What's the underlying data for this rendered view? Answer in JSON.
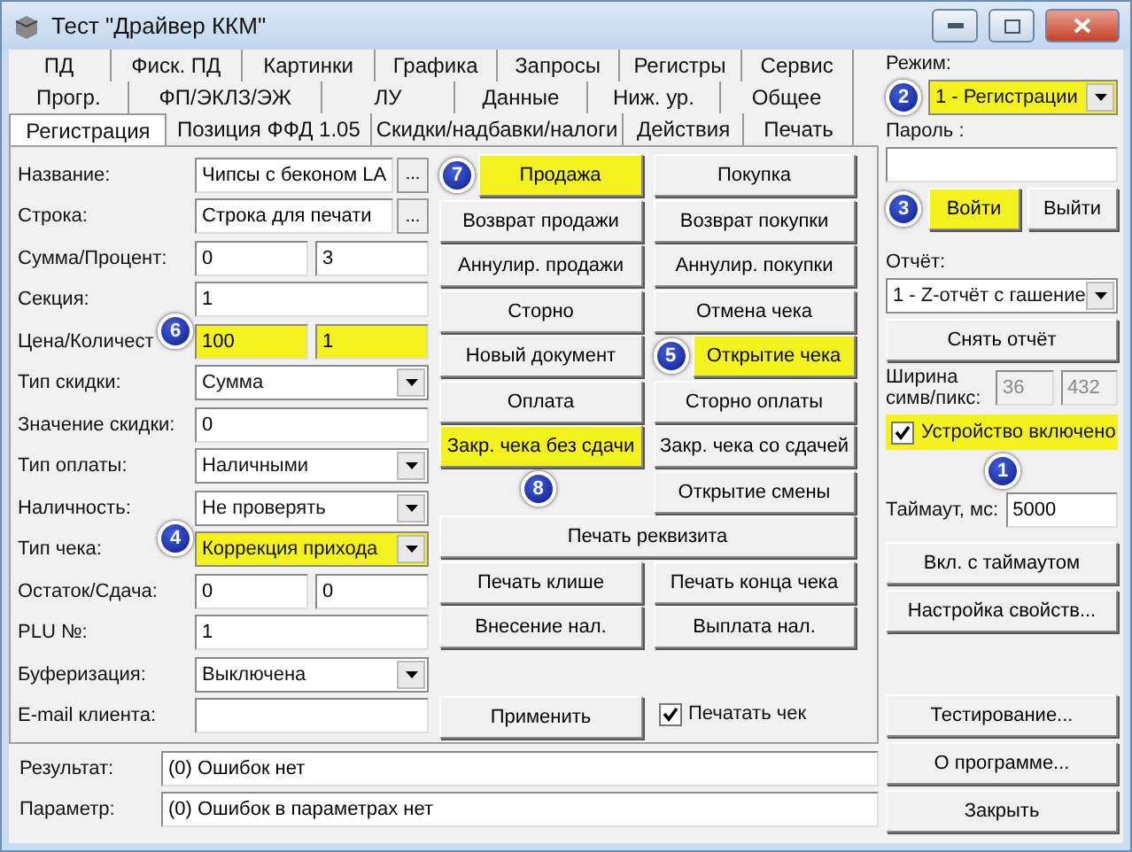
{
  "window": {
    "title": "Тест \"Драйвер ККМ\""
  },
  "tab_rows": [
    [
      {
        "label": "ПД",
        "selected": false
      },
      {
        "label": "Фиск. ПД",
        "selected": false
      },
      {
        "label": "Картинки",
        "selected": false
      },
      {
        "label": "Графика",
        "selected": false
      },
      {
        "label": "Запросы",
        "selected": false
      },
      {
        "label": "Регистры",
        "selected": false
      },
      {
        "label": "Сервис",
        "selected": false
      }
    ],
    [
      {
        "label": "Прогр.",
        "selected": false
      },
      {
        "label": "ФП/ЭКЛЗ/ЭЖ",
        "selected": false
      },
      {
        "label": "ЛУ",
        "selected": false
      },
      {
        "label": "Данные",
        "selected": false
      },
      {
        "label": "Ниж. ур.",
        "selected": false
      },
      {
        "label": "Общее",
        "selected": false
      }
    ],
    [
      {
        "label": "Регистрация",
        "selected": true
      },
      {
        "label": "Позиция ФФД 1.05",
        "selected": false
      },
      {
        "label": "Скидки/надбавки/налоги",
        "selected": false
      },
      {
        "label": "Действия",
        "selected": false
      },
      {
        "label": "Печать",
        "selected": false
      }
    ]
  ],
  "form": [
    {
      "label": "Название:",
      "kind": "text_more",
      "value": "Чипсы с беконом LA",
      "more": "...",
      "highlighted": false
    },
    {
      "label": "Строка:",
      "kind": "text_more",
      "value": "Строка для печати",
      "more": "...",
      "highlighted": false
    },
    {
      "label": "Сумма/Процент:",
      "kind": "pair",
      "values": [
        "0",
        "3"
      ],
      "highlighted": false
    },
    {
      "label": "Секция:",
      "kind": "text",
      "value": "1",
      "highlighted": false
    },
    {
      "label": "Цена/Количест",
      "kind": "pair",
      "values": [
        "100",
        "1"
      ],
      "highlighted": true,
      "callout": "6"
    },
    {
      "label": "Тип скидки:",
      "kind": "select",
      "value": "Сумма",
      "highlighted": false
    },
    {
      "label": "Значение скидки:",
      "kind": "text",
      "value": "0",
      "highlighted": false
    },
    {
      "label": "Тип оплаты:",
      "kind": "select",
      "value": "Наличными",
      "highlighted": false
    },
    {
      "label": "Наличность:",
      "kind": "select",
      "value": "Не проверять",
      "highlighted": false
    },
    {
      "label": "Тип чека:",
      "kind": "select",
      "value": "Коррекция прихода",
      "highlighted": true,
      "callout": "4"
    },
    {
      "label": "Остаток/Сдача:",
      "kind": "pair",
      "values": [
        "0",
        "0"
      ],
      "highlighted": false
    },
    {
      "label": "PLU №:",
      "kind": "text",
      "value": "1",
      "highlighted": false
    },
    {
      "label": "Буферизация:",
      "kind": "select",
      "value": "Выключена",
      "highlighted": false
    },
    {
      "label": "E-mail клиента:",
      "kind": "text",
      "highlighted": false
    }
  ],
  "actions": [
    [
      {
        "kind": "button",
        "label": "Продажа",
        "highlighted": true,
        "callout": "7"
      },
      {
        "kind": "button",
        "label": "Покупка",
        "highlighted": false
      }
    ],
    [
      {
        "kind": "button",
        "label": "Возврат продажи",
        "highlighted": false
      },
      {
        "kind": "button",
        "label": "Возврат покупки",
        "highlighted": false
      }
    ],
    [
      {
        "kind": "button",
        "label": "Аннулир. продажи",
        "highlighted": false
      },
      {
        "kind": "button",
        "label": "Аннулир. покупки",
        "highlighted": false
      }
    ],
    [
      {
        "kind": "button",
        "label": "Сторно",
        "highlighted": false
      },
      {
        "kind": "button",
        "label": "Отмена чека",
        "highlighted": false
      }
    ],
    [
      {
        "kind": "button",
        "label": "Новый документ",
        "highlighted": false
      },
      {
        "kind": "button",
        "label": "Открытие чека",
        "highlighted": true,
        "callout": "5"
      }
    ],
    [
      {
        "kind": "button",
        "label": "Оплата",
        "highlighted": false
      },
      {
        "kind": "button",
        "label": "Сторно оплаты",
        "highlighted": false
      }
    ],
    [
      {
        "kind": "button",
        "label": "Закр. чека без сдачи",
        "highlighted": true,
        "callout": "8",
        "callout_below": true
      },
      {
        "kind": "button",
        "label": "Закр. чека со сдачей",
        "highlighted": false
      }
    ],
    [
      {
        "kind": "blank"
      },
      {
        "kind": "button",
        "label": "Открытие смены",
        "highlighted": false
      }
    ],
    [
      {
        "kind": "wide",
        "label": "Печать реквизита",
        "highlighted": false
      }
    ],
    [
      {
        "kind": "button",
        "label": "Печать клише",
        "highlighted": false
      },
      {
        "kind": "button",
        "label": "Печать конца чека",
        "highlighted": false
      }
    ],
    [
      {
        "kind": "button",
        "label": "Внесение нал.",
        "highlighted": false
      },
      {
        "kind": "button",
        "label": "Выплата нал.",
        "highlighted": false
      }
    ],
    [
      {
        "kind": "blank"
      },
      {
        "kind": "blank"
      }
    ],
    [
      {
        "kind": "button",
        "label": "Применить",
        "highlighted": false
      },
      {
        "kind": "checkbox",
        "label": "Печатать чек",
        "checked": true
      }
    ]
  ],
  "status": [
    {
      "label": "Результат:",
      "value": "(0) Ошибок нет"
    },
    {
      "label": "Параметр:",
      "value": "(0) Ошибок в параметрах нет"
    }
  ],
  "side": {
    "mode": {
      "label": "Режим:",
      "value": "1 - Регистрации",
      "highlighted": true,
      "callout": "2"
    },
    "password": {
      "label": "Пароль :"
    },
    "login": {
      "label": "Войти",
      "highlighted": true,
      "callout": "3"
    },
    "logout": {
      "label": "Выйти",
      "highlighted": false
    },
    "report": {
      "label": "Отчёт:",
      "value": "1 - Z-отчёт с гашение"
    },
    "take_report": "Снять отчёт",
    "width": {
      "label": "Ширина симв/пикс:",
      "values": [
        "36",
        "432"
      ]
    },
    "device": {
      "label": "Устройство включено",
      "checked": true,
      "highlighted": true,
      "callout": "1"
    },
    "timeout": {
      "label": "Таймаут, мс:",
      "value": "5000"
    },
    "buttons_top": [
      "Вкл. с таймаутом",
      "Настройка свойств..."
    ],
    "buttons_bottom": [
      "Тестирование...",
      "О программе...",
      "Закрыть"
    ]
  }
}
